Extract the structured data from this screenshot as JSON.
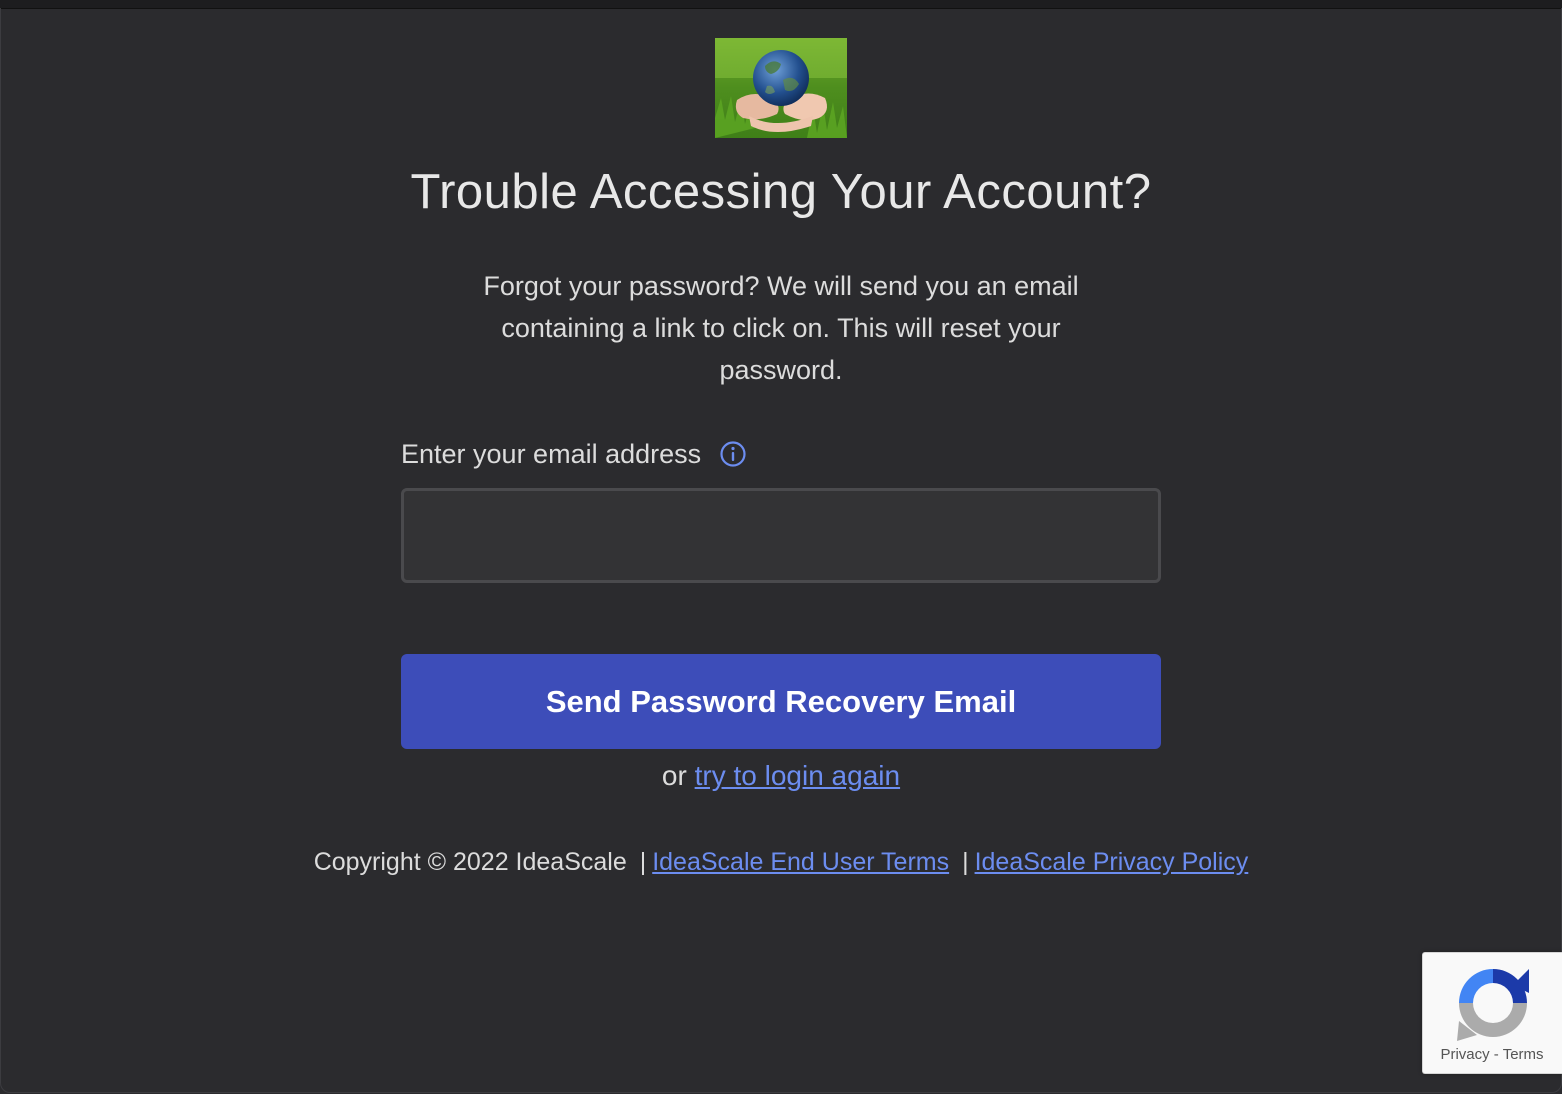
{
  "header": {
    "title": "Trouble Accessing Your Account?"
  },
  "description": "Forgot your password? We will send you an email containing a link to click on. This will reset your password.",
  "form": {
    "email_label": "Enter your email address",
    "email_value": "",
    "email_placeholder": "",
    "submit_label": "Send Password Recovery Email",
    "or_text": "or",
    "login_link": "try to login again"
  },
  "footer": {
    "copyright": "Copyright © 2022 IdeaScale",
    "separator": "|",
    "terms_link": "IdeaScale End User Terms",
    "privacy_link": "IdeaScale Privacy Policy"
  },
  "recaptcha": {
    "privacy": "Privacy",
    "dash": "-",
    "terms": "Terms"
  },
  "colors": {
    "background": "#2b2b2e",
    "accent": "#3d4db9",
    "link": "#6c8df0"
  },
  "icons": {
    "info": "info-icon",
    "logo": "earth-in-hands-logo",
    "recaptcha": "recaptcha-icon"
  }
}
